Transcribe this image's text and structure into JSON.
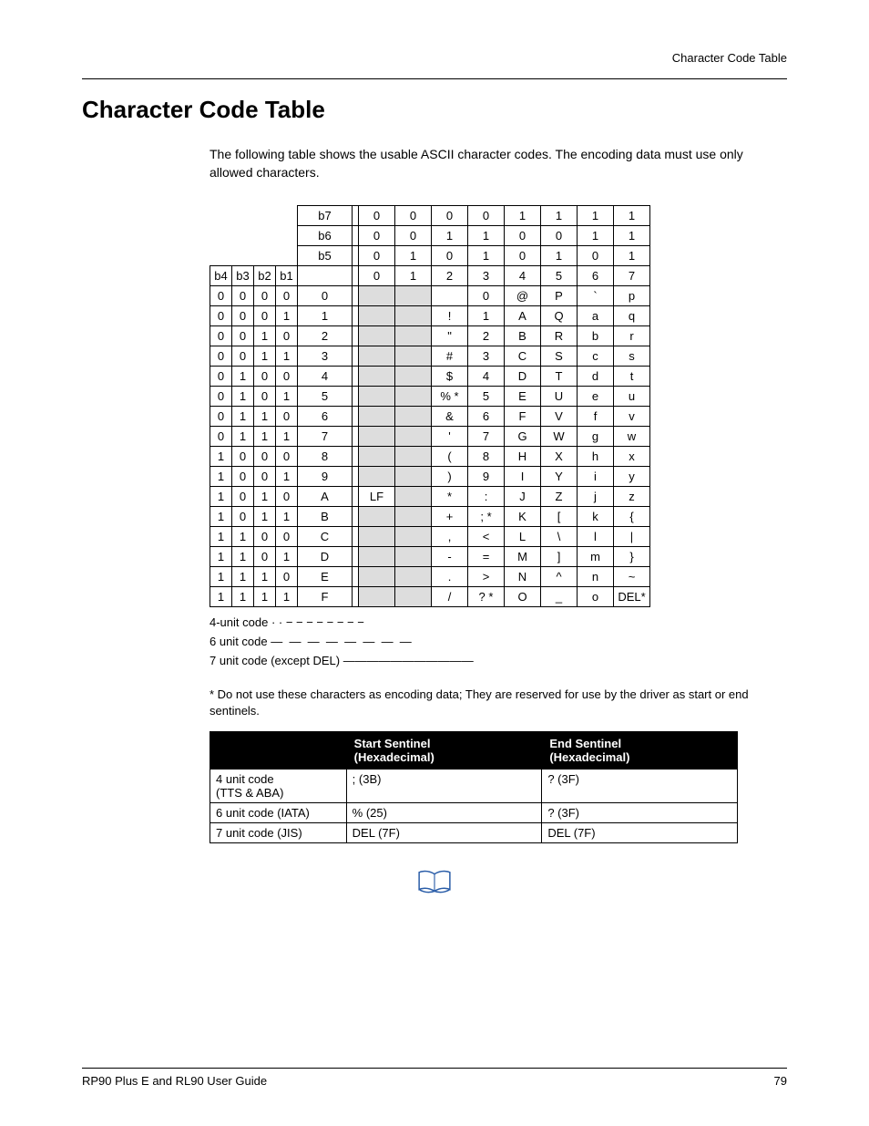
{
  "header": {
    "section": "Character Code Table"
  },
  "title": "Character Code Table",
  "intro": "The following table shows the usable ASCII character codes. The encoding data must use only allowed characters.",
  "ascii": {
    "bit_rows": [
      {
        "label": "b7",
        "vals": [
          "0",
          "0",
          "0",
          "0",
          "1",
          "1",
          "1",
          "1"
        ]
      },
      {
        "label": "b6",
        "vals": [
          "0",
          "0",
          "1",
          "1",
          "0",
          "0",
          "1",
          "1"
        ]
      },
      {
        "label": "b5",
        "vals": [
          "0",
          "1",
          "0",
          "1",
          "0",
          "1",
          "0",
          "1"
        ]
      }
    ],
    "header_bits": [
      "b4",
      "b3",
      "b2",
      "b1"
    ],
    "header_cols": [
      "0",
      "1",
      "2",
      "3",
      "4",
      "5",
      "6",
      "7"
    ],
    "rows": [
      {
        "b": [
          "0",
          "0",
          "0",
          "0"
        ],
        "h": "0",
        "c": [
          "",
          "",
          "",
          "0",
          "@",
          "P",
          "`",
          "p"
        ]
      },
      {
        "b": [
          "0",
          "0",
          "0",
          "1"
        ],
        "h": "1",
        "c": [
          "",
          "",
          "!",
          "1",
          "A",
          "Q",
          "a",
          "q"
        ]
      },
      {
        "b": [
          "0",
          "0",
          "1",
          "0"
        ],
        "h": "2",
        "c": [
          "",
          "",
          "\"",
          "2",
          "B",
          "R",
          "b",
          "r"
        ]
      },
      {
        "b": [
          "0",
          "0",
          "1",
          "1"
        ],
        "h": "3",
        "c": [
          "",
          "",
          "#",
          "3",
          "C",
          "S",
          "c",
          "s"
        ]
      },
      {
        "b": [
          "0",
          "1",
          "0",
          "0"
        ],
        "h": "4",
        "c": [
          "",
          "",
          "$",
          "4",
          "D",
          "T",
          "d",
          "t"
        ]
      },
      {
        "b": [
          "0",
          "1",
          "0",
          "1"
        ],
        "h": "5",
        "c": [
          "",
          "",
          "% *",
          "5",
          "E",
          "U",
          "e",
          "u"
        ]
      },
      {
        "b": [
          "0",
          "1",
          "1",
          "0"
        ],
        "h": "6",
        "c": [
          "",
          "",
          "&",
          "6",
          "F",
          "V",
          "f",
          "v"
        ]
      },
      {
        "b": [
          "0",
          "1",
          "1",
          "1"
        ],
        "h": "7",
        "c": [
          "",
          "",
          "'",
          "7",
          "G",
          "W",
          "g",
          "w"
        ]
      },
      {
        "b": [
          "1",
          "0",
          "0",
          "0"
        ],
        "h": "8",
        "c": [
          "",
          "",
          "(",
          "8",
          "H",
          "X",
          "h",
          "x"
        ]
      },
      {
        "b": [
          "1",
          "0",
          "0",
          "1"
        ],
        "h": "9",
        "c": [
          "",
          "",
          ")",
          "9",
          "I",
          "Y",
          "i",
          "y"
        ]
      },
      {
        "b": [
          "1",
          "0",
          "1",
          "0"
        ],
        "h": "A",
        "c": [
          "LF",
          "",
          "*",
          ":",
          "J",
          "Z",
          "j",
          "z"
        ]
      },
      {
        "b": [
          "1",
          "0",
          "1",
          "1"
        ],
        "h": "B",
        "c": [
          "",
          "",
          "+",
          "; *",
          "K",
          "[",
          "k",
          "{"
        ]
      },
      {
        "b": [
          "1",
          "1",
          "0",
          "0"
        ],
        "h": "C",
        "c": [
          "",
          "",
          ",",
          "<",
          "L",
          "\\",
          "l",
          "|"
        ]
      },
      {
        "b": [
          "1",
          "1",
          "0",
          "1"
        ],
        "h": "D",
        "c": [
          "",
          "",
          "-",
          "=",
          "M",
          "]",
          "m",
          "}"
        ]
      },
      {
        "b": [
          "1",
          "1",
          "1",
          "0"
        ],
        "h": "E",
        "c": [
          "",
          "",
          ".",
          ">",
          "N",
          "^",
          "n",
          "~"
        ]
      },
      {
        "b": [
          "1",
          "1",
          "1",
          "1"
        ],
        "h": "F",
        "c": [
          "",
          "",
          "/",
          "? *",
          "O",
          "_",
          "o",
          "DEL*"
        ]
      }
    ],
    "legend": {
      "l1": "4-unit code",
      "l2": "6 unit code",
      "l3": "7 unit code (except DEL)"
    }
  },
  "footnote": "* Do not use these characters as encoding data; They are reserved for use by the driver as start or end sentinels.",
  "sentinel": {
    "head": [
      "",
      "Start Sentinel (Hexadecimal)",
      "End Sentinel (Hexadecimal)"
    ],
    "rows": [
      {
        "name": "4 unit code\n(TTS & ABA)",
        "start": "; (3B)",
        "end": "? (3F)"
      },
      {
        "name": "6 unit code (IATA)",
        "start": "% (25)",
        "end": "? (3F)"
      },
      {
        "name": "7 unit code (JIS)",
        "start": "DEL (7F)",
        "end": "DEL (7F)"
      }
    ]
  },
  "footer": {
    "left": "RP90 Plus E and RL90 User Guide",
    "right": "79"
  }
}
